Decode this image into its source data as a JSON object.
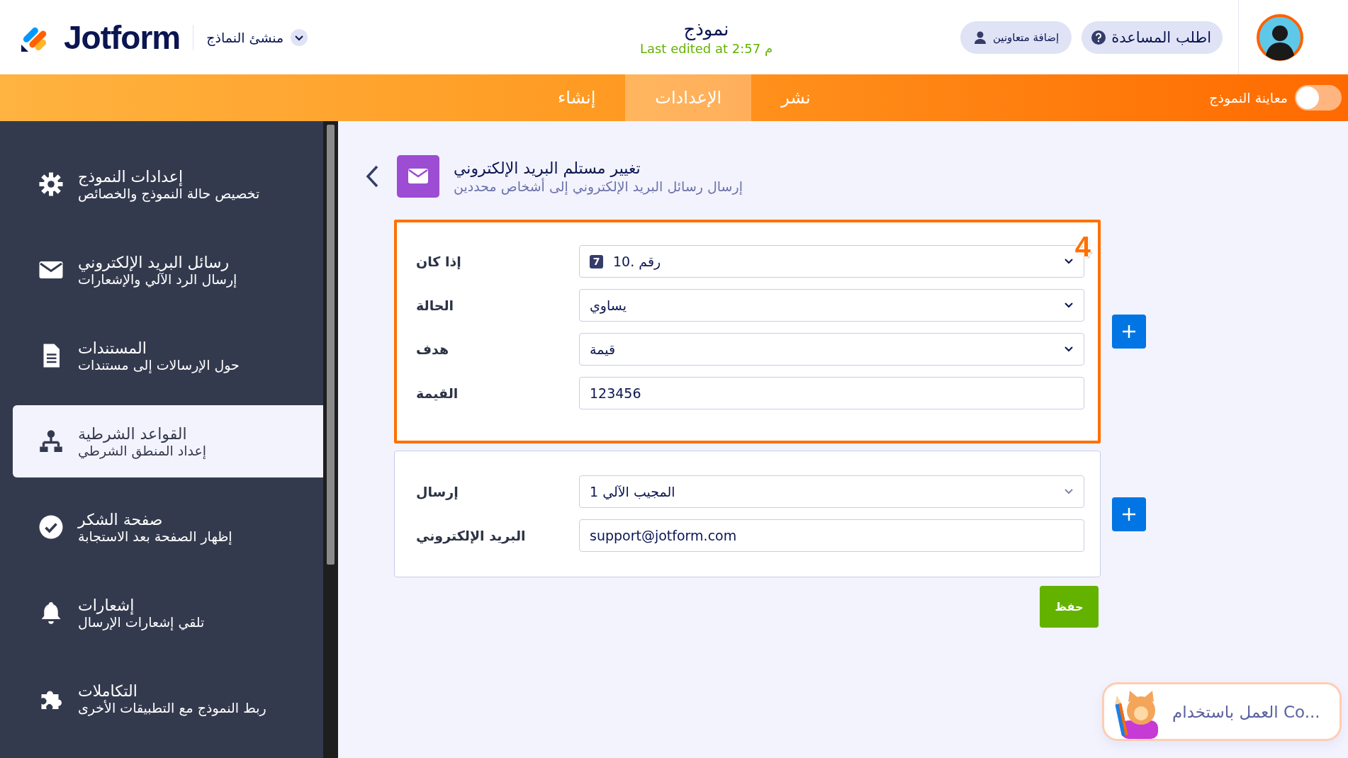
{
  "header": {
    "logo": "Jotform",
    "builder_menu": "منشئ النماذج",
    "form_title": "نموذج",
    "last_edited": "Last edited at 2:57 م",
    "buttons": [
      {
        "kind": "help",
        "label": "اطلب المساعدة"
      },
      {
        "kind": "collaborators",
        "label": "إضافة متعاونين"
      }
    ]
  },
  "tabs": [
    {
      "label": "نشر",
      "selected": false
    },
    {
      "label": "الإعدادات",
      "selected": true
    },
    {
      "label": "إنشاء",
      "selected": false
    }
  ],
  "preview": {
    "label": "معاينة النموذج",
    "on": false
  },
  "sidebar": {
    "items": [
      {
        "title": "إعدادات النموذج",
        "subtitle": "تخصيص حالة النموذج والخصائص",
        "selected": false
      },
      {
        "title": "رسائل البريد الإلكتروني",
        "subtitle": "إرسال الرد الآلي والإشعارات",
        "selected": false
      },
      {
        "title": "المستندات",
        "subtitle": "حول الإرسالات إلى مستندات",
        "selected": false
      },
      {
        "title": "القواعد الشرطية",
        "subtitle": "إعداد المنطق الشرطي",
        "selected": true
      },
      {
        "title": "صفحة الشكر",
        "subtitle": "إظهار الصفحة بعد الاستجابة",
        "selected": false
      },
      {
        "title": "إشعارات",
        "subtitle": "تلقي إشعارات الإرسال",
        "selected": false
      },
      {
        "title": "التكاملات",
        "subtitle": "ربط النموذج مع التطبيقات الأخرى",
        "selected": false
      }
    ]
  },
  "panel": {
    "title": "تغيير مستلم البريد الإلكتروني",
    "subtitle": "إرسال رسائل البريد الإلكتروني إلى أشخاص محددين",
    "condition": {
      "step_badge": "4",
      "highlighted": true,
      "rows": [
        {
          "label": "إذا كان",
          "kind": "dropdown",
          "field_badge": "7",
          "value": "10. رقم"
        },
        {
          "label": "الحالة",
          "kind": "dropdown",
          "value": "يساوي"
        },
        {
          "label": "هدف",
          "kind": "dropdown",
          "value": "قيمة"
        },
        {
          "label": "القيمة",
          "kind": "text",
          "value": "123456"
        }
      ]
    },
    "action": {
      "highlighted": false,
      "rows": [
        {
          "label": "إرسال",
          "kind": "dropdown",
          "value": "المجيب الآلي 1"
        },
        {
          "label": "البريد الإلكتروني",
          "kind": "text",
          "value": "support@jotform.com"
        }
      ]
    },
    "save_button": "حفظ"
  },
  "assistant": {
    "text": "العمل باستخدام Co..."
  }
}
